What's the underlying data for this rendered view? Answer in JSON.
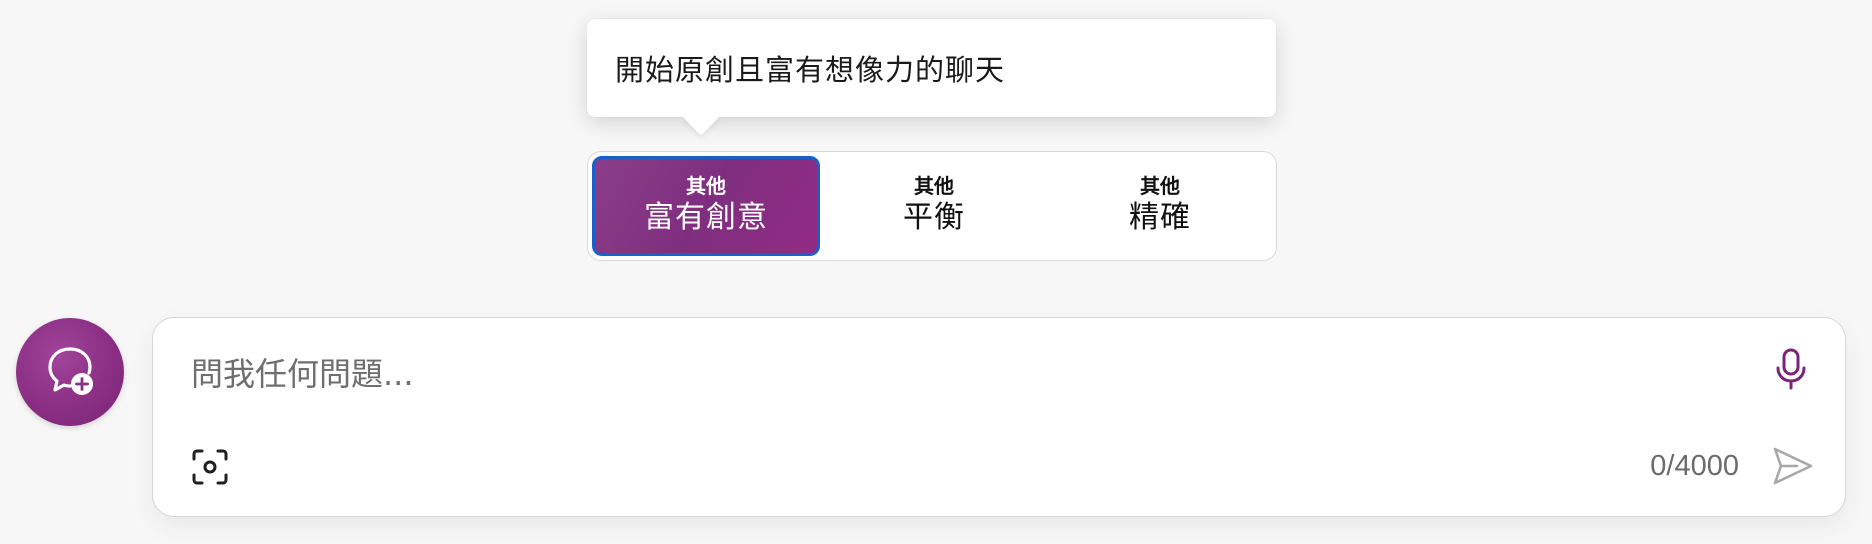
{
  "tooltip": {
    "text": "開始原創且富有想像力的聊天"
  },
  "conversation_styles": [
    {
      "small_label": "其他",
      "label": "富有創意",
      "selected": true
    },
    {
      "small_label": "其他",
      "label": "平衡",
      "selected": false
    },
    {
      "small_label": "其他",
      "label": "精確",
      "selected": false
    }
  ],
  "composer": {
    "placeholder": "問我任何問題...",
    "value": "",
    "char_count": "0/4000"
  },
  "icons": {
    "new_topic": "new-topic-chat-bubble-plus-icon",
    "mic": "microphone-icon",
    "visual_search": "camera-scan-icon",
    "send": "send-arrow-icon"
  },
  "colors": {
    "accent_purple": "#8a2f84",
    "selected_border": "#1b5fc9",
    "background": "#f7f7f7"
  }
}
